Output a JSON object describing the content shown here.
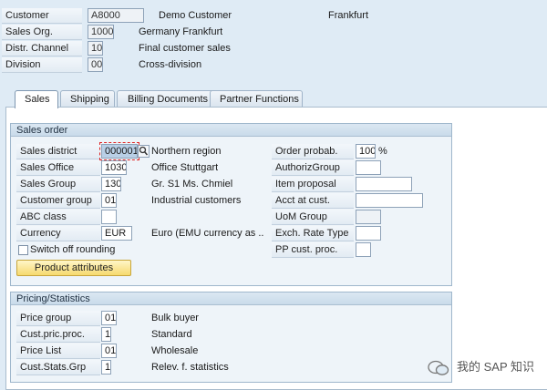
{
  "header": {
    "customer": {
      "label": "Customer",
      "value": "A8000",
      "desc": "Demo Customer",
      "city": "Frankfurt"
    },
    "sales_org": {
      "label": "Sales Org.",
      "value": "1000",
      "desc": "Germany Frankfurt"
    },
    "distr_channel": {
      "label": "Distr. Channel",
      "value": "10",
      "desc": "Final customer sales"
    },
    "division": {
      "label": "Division",
      "value": "00",
      "desc": "Cross-division"
    }
  },
  "tabs": [
    {
      "label": "Sales",
      "active": true
    },
    {
      "label": "Shipping"
    },
    {
      "label": "Billing Documents"
    },
    {
      "label": "Partner Functions"
    }
  ],
  "sales_order": {
    "title": "Sales order",
    "sales_district": {
      "label": "Sales district",
      "value": "000001",
      "desc": "Northern region"
    },
    "sales_office": {
      "label": "Sales Office",
      "value": "1030",
      "desc": "Office Stuttgart"
    },
    "sales_group": {
      "label": "Sales Group",
      "value": "130",
      "desc": "Gr. S1 Ms. Chmiel"
    },
    "customer_group": {
      "label": "Customer group",
      "value": "01",
      "desc": "Industrial customers"
    },
    "abc_class": {
      "label": "ABC class",
      "value": ""
    },
    "currency": {
      "label": "Currency",
      "value": "EUR",
      "desc": "Euro (EMU currency as .."
    },
    "switch_off_rounding": {
      "label": "Switch off rounding"
    },
    "product_attributes_btn": "Product attributes",
    "order_probab": {
      "label": "Order probab.",
      "value": "100",
      "unit": "%"
    },
    "authoriz_group": {
      "label": "AuthorizGroup",
      "value": ""
    },
    "item_proposal": {
      "label": "Item proposal",
      "value": ""
    },
    "acct_at_cust": {
      "label": "Acct at cust.",
      "value": ""
    },
    "uom_group": {
      "label": "UoM Group",
      "value": ""
    },
    "exch_rate_type": {
      "label": "Exch. Rate Type",
      "value": ""
    },
    "pp_cust_proc": {
      "label": "PP cust. proc.",
      "value": ""
    }
  },
  "pricing": {
    "title": "Pricing/Statistics",
    "price_group": {
      "label": "Price group",
      "value": "01",
      "desc": "Bulk buyer"
    },
    "cust_pric_proc": {
      "label": "Cust.pric.proc.",
      "value": "1",
      "desc": "Standard"
    },
    "price_list": {
      "label": "Price List",
      "value": "01",
      "desc": "Wholesale"
    },
    "cust_stats_grp": {
      "label": "Cust.Stats.Grp",
      "value": "1",
      "desc": "Relev. f. statistics"
    }
  },
  "watermark": "我的 SAP 知识"
}
